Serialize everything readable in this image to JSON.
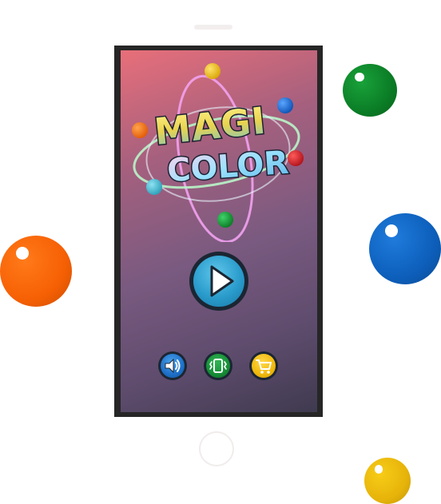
{
  "game": {
    "title_line1": "MAGI",
    "title_line2": "COLOR"
  },
  "menu": {
    "play_button": "play",
    "sound_button": "sound",
    "vibrate_button": "vibrate",
    "shop_button": "shop"
  },
  "icons": {
    "play": "play-icon",
    "sound": "speaker-icon",
    "vibrate": "vibrate-icon",
    "shop": "cart-icon"
  },
  "colors": {
    "ball_green": "#0b7d26",
    "ball_blue": "#0d5fbb",
    "ball_orange": "#f66004",
    "ball_yellow": "#e7b40a",
    "ball_red": "#c3141b",
    "screen_gradient_top": "#e86f7a",
    "screen_gradient_bottom": "#3f3a4f"
  }
}
